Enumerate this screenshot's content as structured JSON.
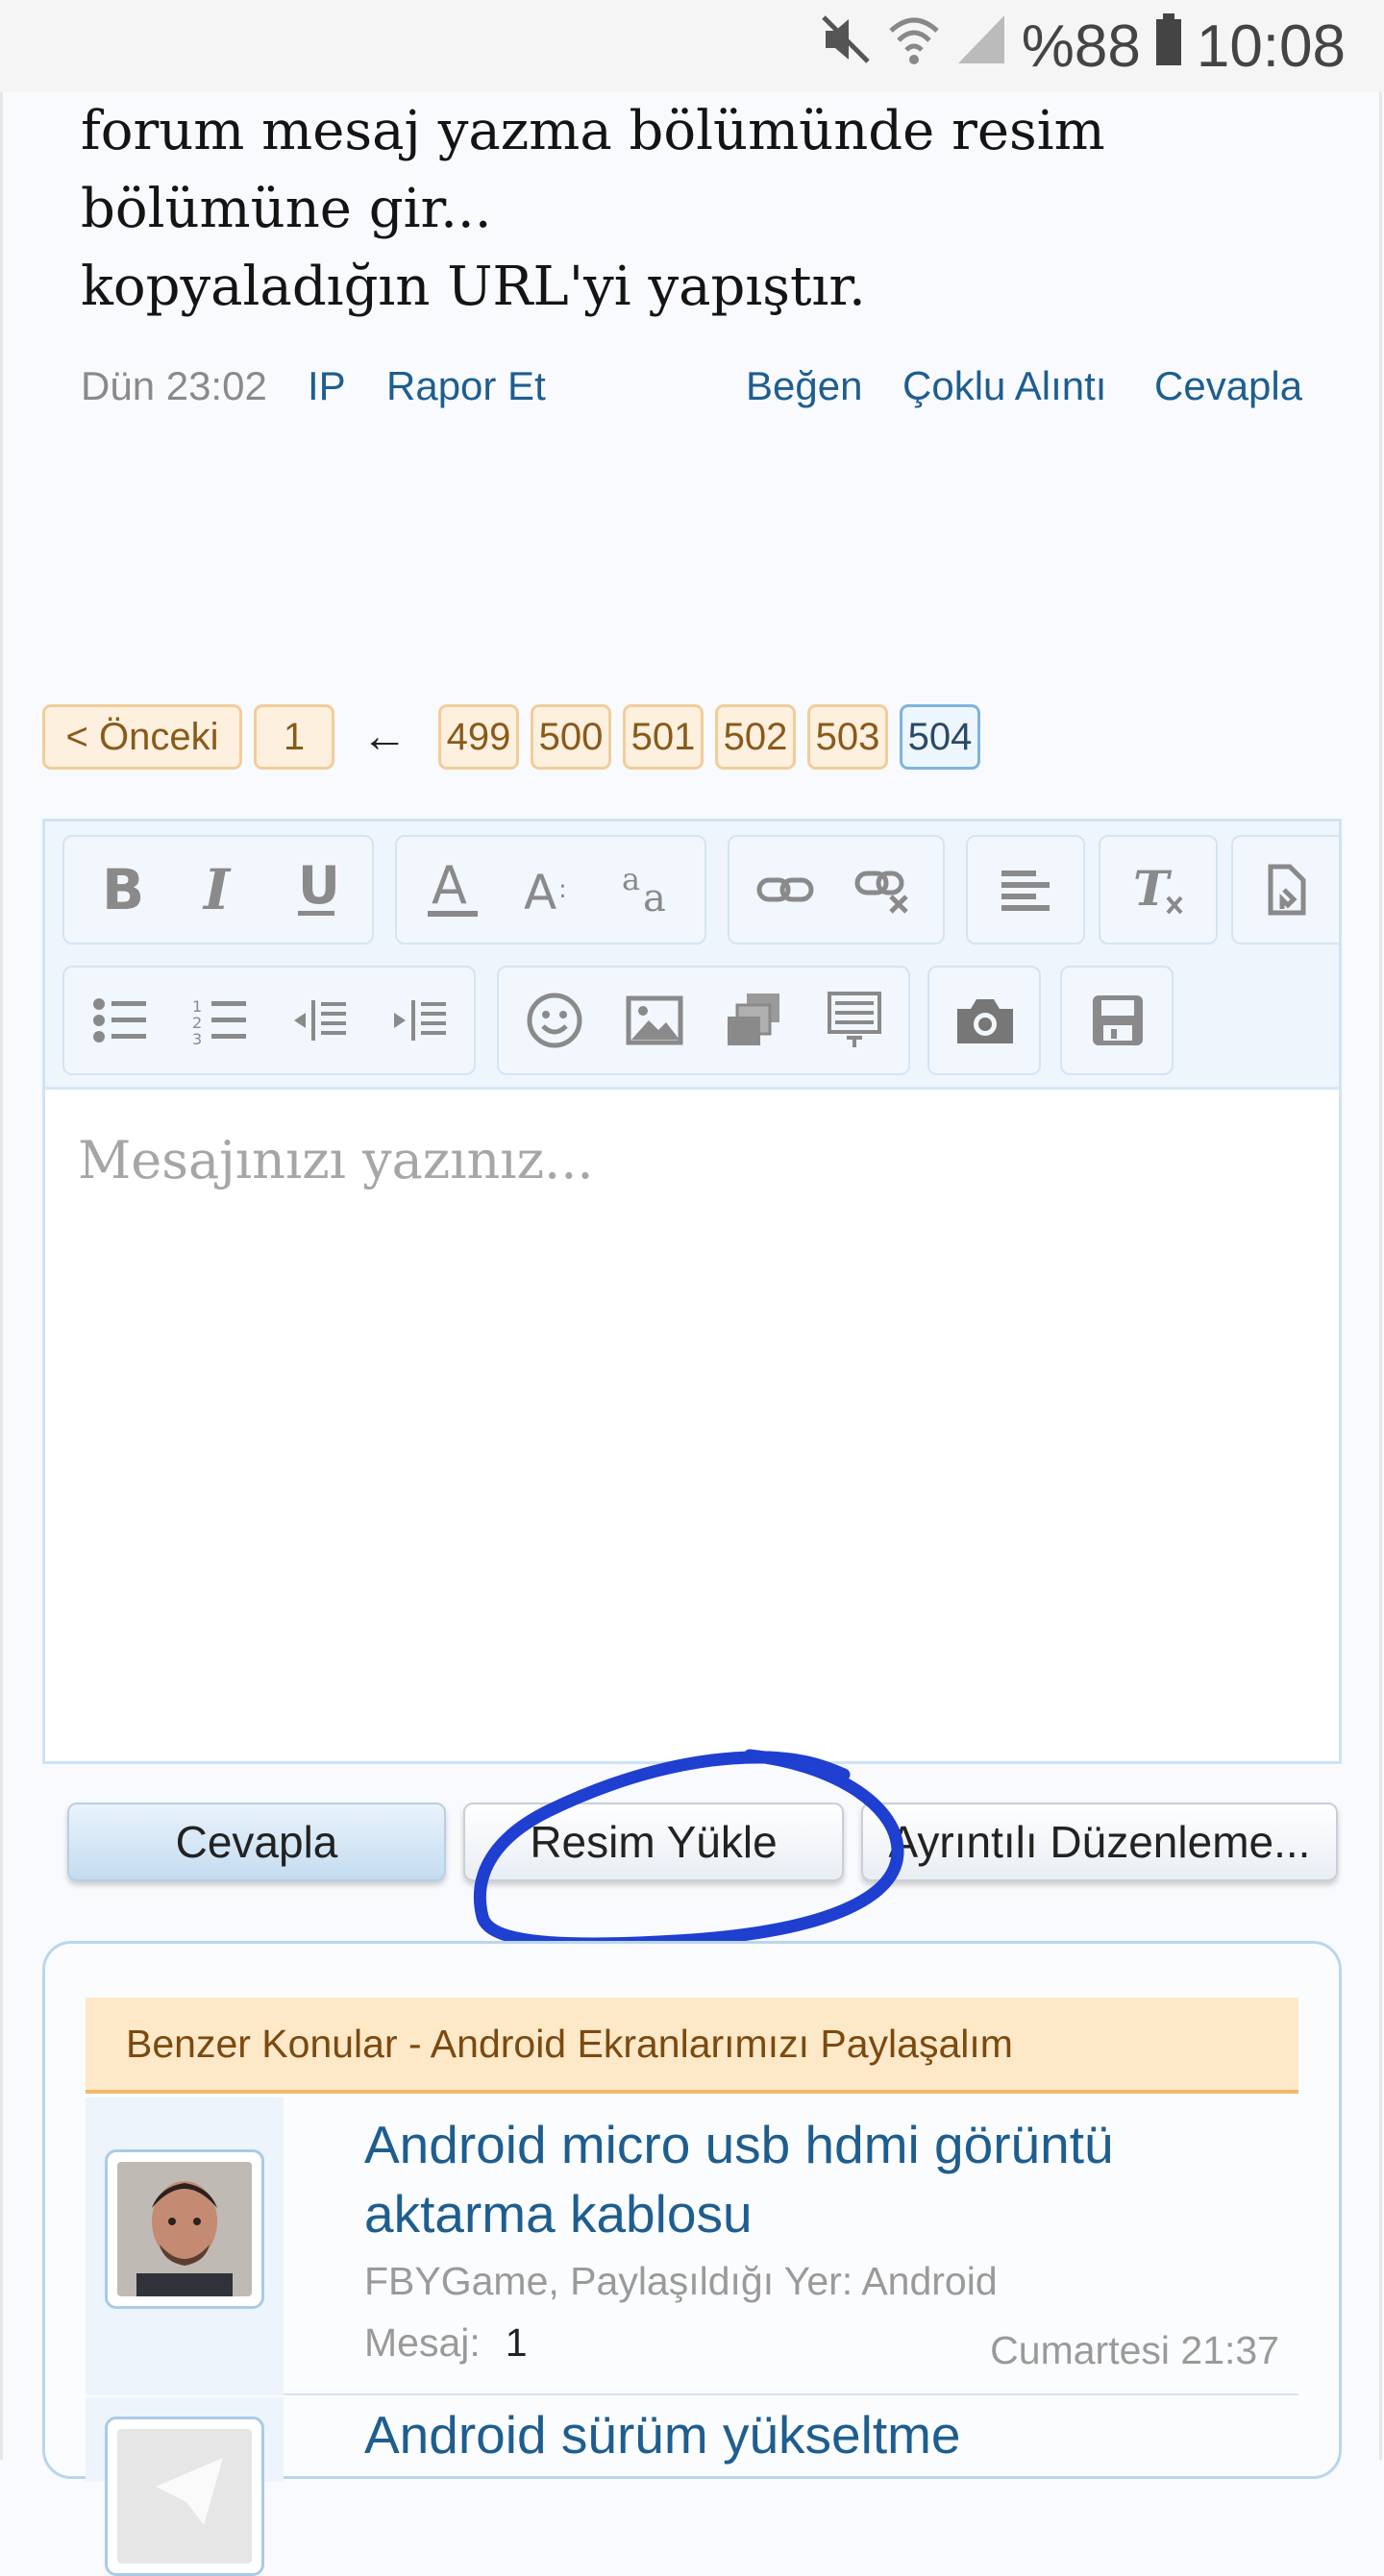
{
  "status_bar": {
    "battery": "%88",
    "time": "10:08"
  },
  "post": {
    "lines": [
      "forum mesaj yazma bölümünde resim",
      "bölümüne gir...",
      "kopyaladığın URL'yi yapıştır."
    ],
    "time": "Dün 23:02",
    "actions": {
      "ip": "IP",
      "report": "Rapor Et",
      "like": "Beğen",
      "multi_quote": "Çoklu Alıntı",
      "reply": "Cevapla"
    }
  },
  "pagination": {
    "prev": "< Önceki",
    "first": "1",
    "arrow": "←",
    "pages": [
      "499",
      "500",
      "501",
      "502",
      "503",
      "504"
    ],
    "current": "504"
  },
  "editor": {
    "placeholder": "Mesajınızı yazınız...",
    "toolbar_row1": [
      "bold-icon",
      "italic-icon",
      "underline-icon",
      "font-color-icon",
      "font-size-icon",
      "font-family-icon",
      "link-icon",
      "unlink-icon",
      "align-icon",
      "remove-format-icon",
      "bb-code-icon"
    ],
    "toolbar_row2": [
      "bullet-list-icon",
      "numbered-list-icon",
      "outdent-icon",
      "indent-icon",
      "smiley-icon",
      "image-icon",
      "media-icon",
      "insert-icon",
      "camera-icon",
      "save-icon"
    ]
  },
  "buttons": {
    "reply": "Cevapla",
    "upload_image": "Resim Yükle",
    "advanced_edit": "Ayrıntılı Düzenleme..."
  },
  "annotation": {
    "circle_color": "#1f3fd0"
  },
  "similar": {
    "header": "Benzer Konular - Android Ekranlarımızı Paylaşalım",
    "threads": [
      {
        "title_line1": "Android micro usb hdmi görüntü",
        "title_line2": "aktarma kablosu",
        "sub": "FBYGame, Paylaşıldığı Yer: Android",
        "msg_label": "Mesaj:",
        "msg_count": "1",
        "date": "Cumartesi 21:37"
      },
      {
        "title_line1": "Android sürüm yükseltme"
      }
    ]
  },
  "colors": {
    "link": "#1e5e8f",
    "page_tab_border": "#f1cd9a",
    "current_page_border": "#7fb3dd",
    "header_bg": "#fde8c8"
  }
}
